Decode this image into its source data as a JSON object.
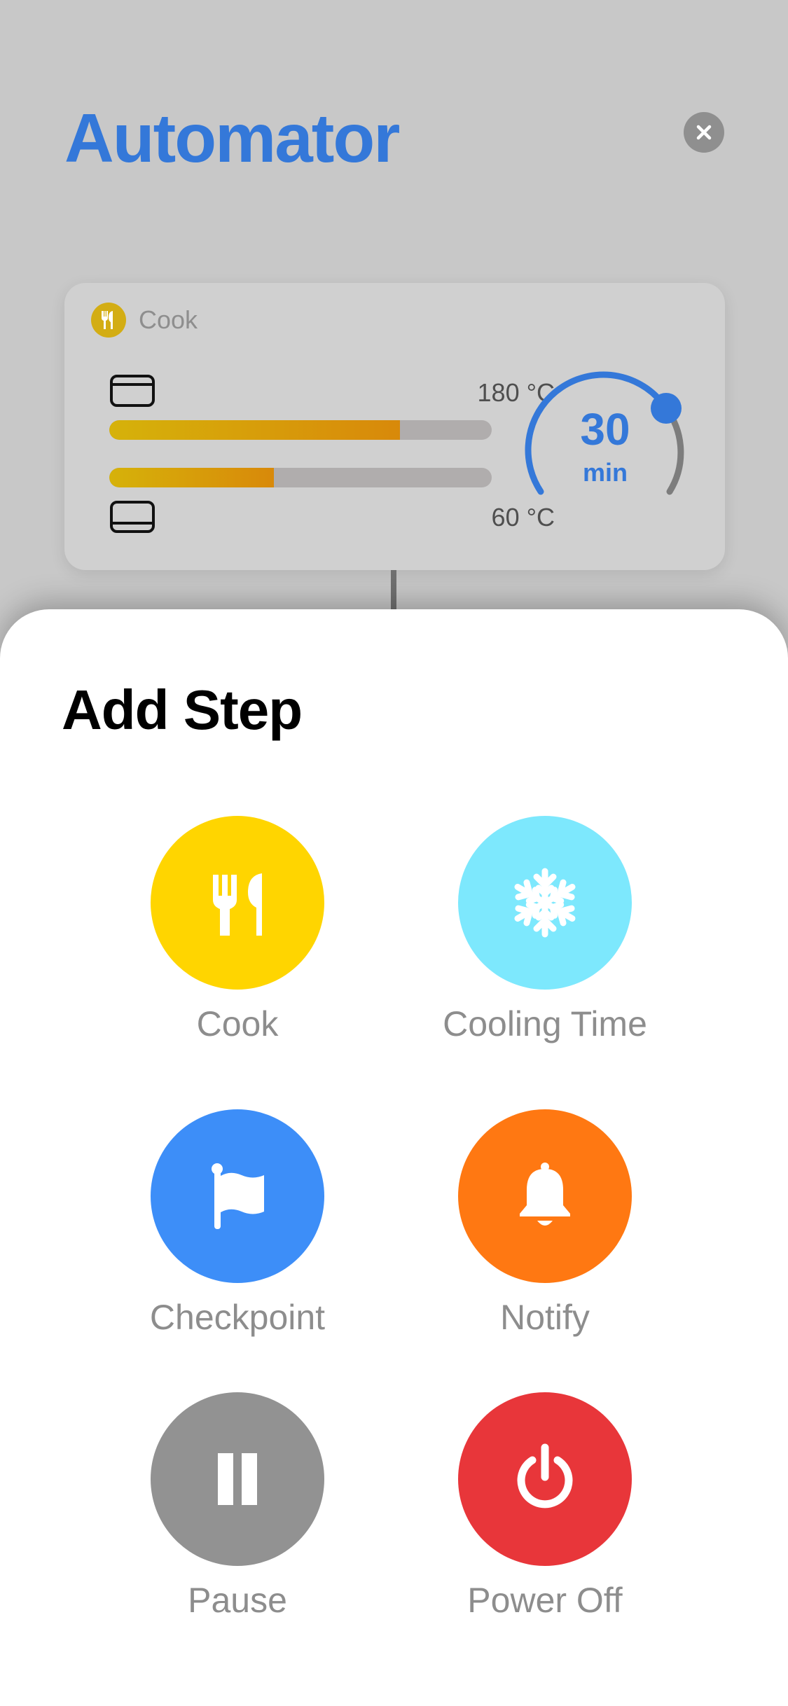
{
  "app": {
    "title": "Automator",
    "close_icon": "close-icon"
  },
  "step_card": {
    "type_label": "Cook",
    "type_icon": "fork-knife-icon",
    "type_color": "#d3ad14",
    "top_heat": {
      "icon": "oven-top-heat-icon",
      "temperature": "180 °C",
      "level_percent": 76
    },
    "bottom_heat": {
      "icon": "oven-bottom-heat-icon",
      "temperature": "60 °C",
      "level_percent": 43
    },
    "timer": {
      "value": "30",
      "unit": "min",
      "accent": "#3478d9"
    }
  },
  "sheet": {
    "title": "Add Step",
    "options": [
      {
        "label": "Cook",
        "icon": "fork-knife-icon",
        "color": "#ffd500"
      },
      {
        "label": "Cooling Time",
        "icon": "snowflake-icon",
        "color": "#7de8fd"
      },
      {
        "label": "Checkpoint",
        "icon": "flag-icon",
        "color": "#3d8ef8"
      },
      {
        "label": "Notify",
        "icon": "bell-icon",
        "color": "#ff7812"
      },
      {
        "label": "Pause",
        "icon": "pause-icon",
        "color": "#929292"
      },
      {
        "label": "Power Off",
        "icon": "power-icon",
        "color": "#e8363a"
      }
    ]
  }
}
